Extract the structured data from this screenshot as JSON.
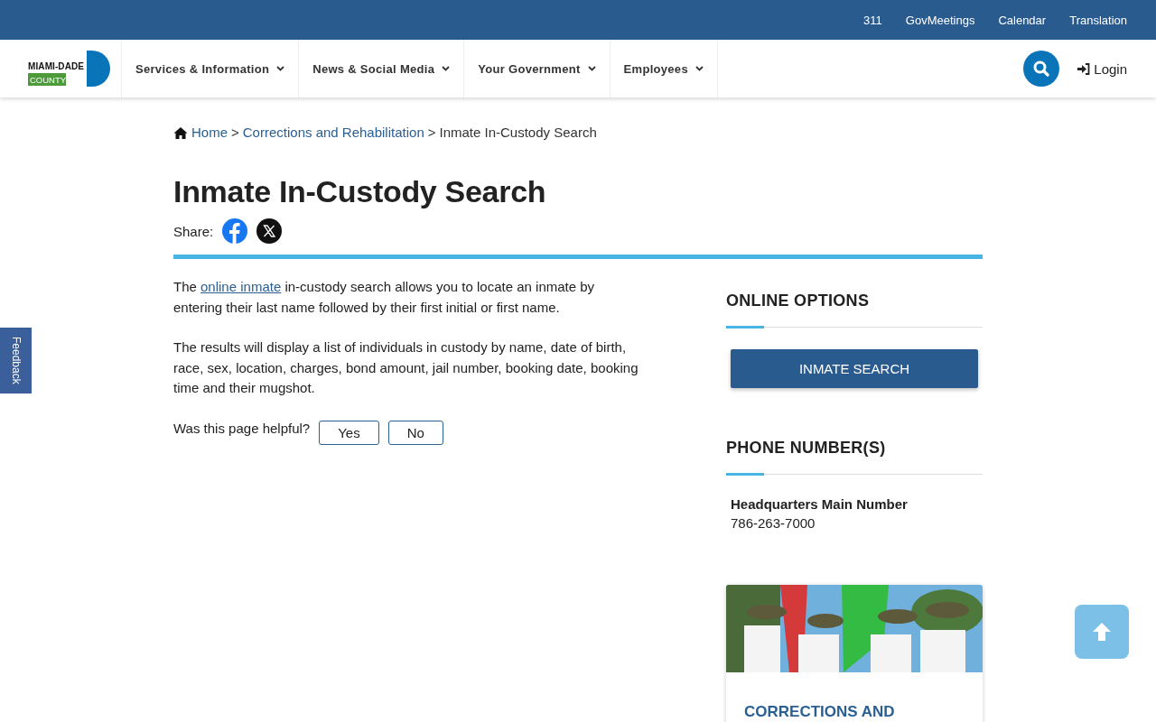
{
  "top_links": [
    "311",
    "GovMeetings",
    "Calendar",
    "Translation"
  ],
  "logo": {
    "line1": "MIAMI-DADE",
    "line2": "COUNTY"
  },
  "nav": [
    {
      "label": "Services & Information",
      "expanded": false
    },
    {
      "label": "News & Social Media",
      "expanded": false
    },
    {
      "label": "Your Government",
      "expanded": false
    },
    {
      "label": "Employees",
      "expanded": false
    }
  ],
  "login": "Login",
  "breadcrumb": [
    {
      "label": "Home",
      "kind": "link"
    },
    {
      "label": ">",
      "kind": "sep"
    },
    {
      "label": "Corrections and Rehabilitation",
      "kind": "link"
    },
    {
      "label": ">",
      "kind": "sep"
    },
    {
      "label": "Inmate In-Custody Search",
      "kind": "current"
    }
  ],
  "title": "Inmate In-Custody Search",
  "share": {
    "label": "Share:"
  },
  "intro": {
    "before": "The ",
    "link": "online inmate",
    "after": " in-custody search allows you to locate an inmate by entering their last name followed by their first initial or first name."
  },
  "paragraph": "The results will display a list of individuals in custody by name, date of birth, race, sex, location, charges, bond amount, jail number, booking date, booking time and their mugshot.",
  "feedback_question": "Was this page helpful?",
  "feedback_buttons": [
    "Yes",
    "No"
  ],
  "sidebar": [
    {
      "heading": "ONLINE OPTIONS",
      "kind": "button",
      "button": "INMATE SEARCH"
    },
    {
      "heading": "PHONE NUMBER(S)",
      "kind": "phone",
      "name": "Headquarters Main Number",
      "number": "786-263-7000"
    }
  ],
  "card": {
    "title": "CORRECTIONS AND"
  },
  "feedback_tab": "Feedback"
}
